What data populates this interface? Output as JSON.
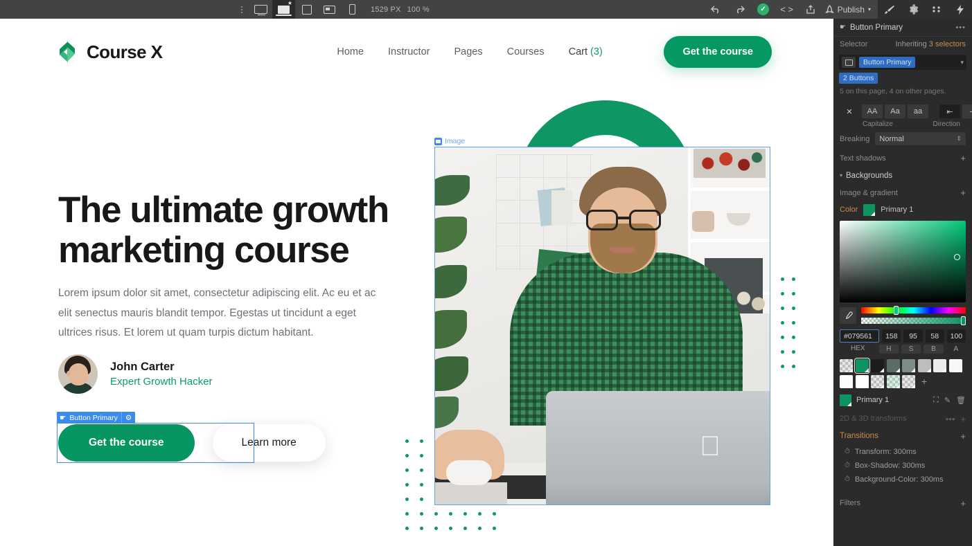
{
  "topbar": {
    "viewports": [
      {
        "name": "desktop",
        "active": false
      },
      {
        "name": "laptop",
        "active": true
      },
      {
        "name": "tablet-portrait",
        "active": false
      },
      {
        "name": "tablet-landscape",
        "active": false
      },
      {
        "name": "mobile",
        "active": false
      }
    ],
    "width_value": "1529 PX",
    "zoom_value": "100 %",
    "publish_label": "Publish",
    "icons": [
      "undo-icon",
      "redo-icon",
      "status-check-icon",
      "code-icon",
      "share-icon",
      "rocket-icon",
      "paint-icon",
      "gear-icon",
      "interactions-icon",
      "lightning-icon"
    ]
  },
  "site": {
    "logo_text": "Course X",
    "nav": [
      {
        "label": "Home"
      },
      {
        "label": "Instructor"
      },
      {
        "label": "Pages"
      },
      {
        "label": "Courses"
      }
    ],
    "cart_label": "Cart ",
    "cart_count": "(3)",
    "nav_cta": "Get the course",
    "hero_title": "The ultimate growth marketing course",
    "hero_sub": "Lorem ipsum dolor sit amet, consectetur adipiscing elit. Ac eu et ac elit senectus mauris blandit tempor. Egestas ut tincidunt a eget ultrices risus. Et lorem ut quam turpis dictum habitant.",
    "author_name": "John Carter",
    "author_role": "Expert Growth Hacker",
    "btn_primary": "Get the course",
    "btn_secondary": "Learn more",
    "selection_tag": "Button Primary",
    "image_tag": "Image"
  },
  "panel": {
    "title": "Button Primary",
    "more": "•••",
    "selector_label": "Selector",
    "inheriting_prefix": "Inheriting ",
    "inheriting_count": "3 selectors",
    "selector_chip": "Button Primary",
    "selector_chip2": "2 Buttons",
    "usage_note": "5 on this page, 4 on other pages.",
    "typography": {
      "none": "✕",
      "all_caps": "AA",
      "title_case": "Aa",
      "lower_case": "aa",
      "cap_label": "Capitalize",
      "dir_label": "Direction",
      "dir_ltr": "⇤",
      "dir_rtl": "⇥"
    },
    "breaking_label": "Breaking",
    "breaking_value": "Normal",
    "text_shadows_label": "Text shadows",
    "backgrounds_label": "Backgrounds",
    "image_gradient_label": "Image & gradient",
    "color_label": "Color",
    "color_name": "Primary 1",
    "hex": "#079561",
    "h": "158",
    "s": "95",
    "b": "58",
    "a": "100",
    "hex_label": "HEX",
    "h_label": "H",
    "s_label": "S",
    "b_label": "B",
    "a_label": "A",
    "swatch_name": "Primary 1",
    "swatches": [
      "transparent",
      "#0d9461",
      "#1c1c1c",
      "#5b6b66",
      "#7d8c88",
      "#bdbdbd",
      "#ececec",
      "#f7f7f7",
      "#fbfbfb",
      "#ffffff",
      "transparent",
      "#cfe0d8",
      "transparent"
    ],
    "transforms_label": "2D & 3D transforms",
    "transitions_label": "Transitions",
    "transitions": [
      {
        "label": "Transform: 300ms"
      },
      {
        "label": "Box-Shadow: 300ms"
      },
      {
        "label": "Background-Color: 300ms"
      }
    ],
    "filters_label": "Filters",
    "plus": "+"
  }
}
